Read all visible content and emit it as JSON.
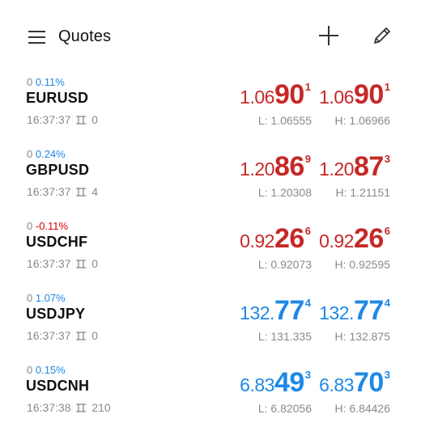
{
  "header": {
    "title": "Quotes"
  },
  "colors": {
    "down": "#c62828",
    "up": "#1e88e5",
    "pos_change": "#1e88e5",
    "neg_change": "#d50000",
    "muted": "#8a8a8a"
  },
  "quotes": [
    {
      "change_abs": "0",
      "change_pct": "0.11%",
      "change_dir": "pos",
      "symbol": "EURUSD",
      "time": "16:37:37",
      "spread": "0",
      "bid": {
        "small": "1.06",
        "big": "90",
        "sup": "1"
      },
      "ask": {
        "small": "1.06",
        "big": "90",
        "sup": "1"
      },
      "price_dir": "down",
      "low": "L: 1.06555",
      "high": "H: 1.06966"
    },
    {
      "change_abs": "0",
      "change_pct": "0.24%",
      "change_dir": "pos",
      "symbol": "GBPUSD",
      "time": "16:37:37",
      "spread": "4",
      "bid": {
        "small": "1.20",
        "big": "86",
        "sup": "9"
      },
      "ask": {
        "small": "1.20",
        "big": "87",
        "sup": "3"
      },
      "price_dir": "down",
      "low": "L: 1.20308",
      "high": "H: 1.21151"
    },
    {
      "change_abs": "0",
      "change_pct": "-0.11%",
      "change_dir": "neg",
      "symbol": "USDCHF",
      "time": "16:37:37",
      "spread": "0",
      "bid": {
        "small": "0.92",
        "big": "26",
        "sup": "6"
      },
      "ask": {
        "small": "0.92",
        "big": "26",
        "sup": "6"
      },
      "price_dir": "down",
      "low": "L: 0.92073",
      "high": "H: 0.92595"
    },
    {
      "change_abs": "0",
      "change_pct": "1.07%",
      "change_dir": "pos",
      "symbol": "USDJPY",
      "time": "16:37:37",
      "spread": "0",
      "bid": {
        "small": "132.",
        "big": "77",
        "sup": "4"
      },
      "ask": {
        "small": "132.",
        "big": "77",
        "sup": "4"
      },
      "price_dir": "up",
      "low": "L: 131.335",
      "high": "H: 132.875"
    },
    {
      "change_abs": "0",
      "change_pct": "0.15%",
      "change_dir": "pos",
      "symbol": "USDCNH",
      "time": "16:37:38",
      "spread": "210",
      "bid": {
        "small": "6.83",
        "big": "49",
        "sup": "3"
      },
      "ask": {
        "small": "6.83",
        "big": "70",
        "sup": "3"
      },
      "price_dir": "up",
      "low": "L: 6.82056",
      "high": "H: 6.84426"
    }
  ]
}
